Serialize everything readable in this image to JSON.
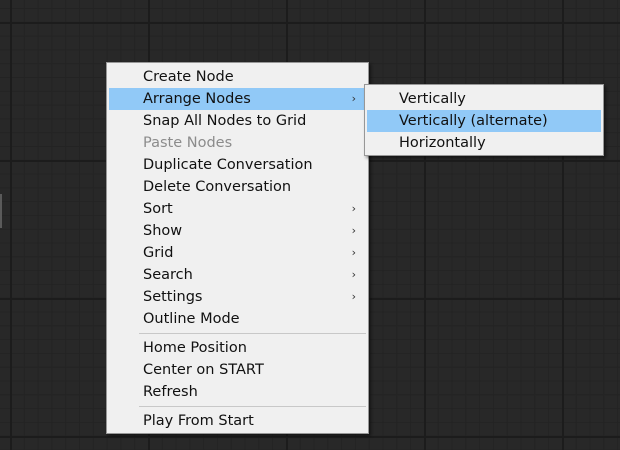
{
  "context_menu": {
    "items": [
      {
        "label": "Create Node"
      },
      {
        "label": "Arrange Nodes",
        "arrow": "›"
      },
      {
        "label": "Snap All Nodes to Grid"
      },
      {
        "label": "Paste Nodes"
      },
      {
        "label": "Duplicate Conversation"
      },
      {
        "label": "Delete Conversation"
      },
      {
        "label": "Sort",
        "arrow": "›"
      },
      {
        "label": "Show",
        "arrow": "›"
      },
      {
        "label": "Grid",
        "arrow": "›"
      },
      {
        "label": "Search",
        "arrow": "›"
      },
      {
        "label": "Settings",
        "arrow": "›"
      },
      {
        "label": "Outline Mode"
      },
      {
        "label": "Home Position"
      },
      {
        "label": "Center on START"
      },
      {
        "label": "Refresh"
      },
      {
        "label": "Play From Start"
      }
    ]
  },
  "arrange_submenu": {
    "items": [
      {
        "label": "Vertically"
      },
      {
        "label": "Vertically (alternate)"
      },
      {
        "label": "Horizontally"
      }
    ]
  },
  "colors": {
    "canvas_background": "#282828",
    "menu_background": "#f0f0f0",
    "highlight": "#91c9f7",
    "disabled_text": "#8c8c8c"
  }
}
